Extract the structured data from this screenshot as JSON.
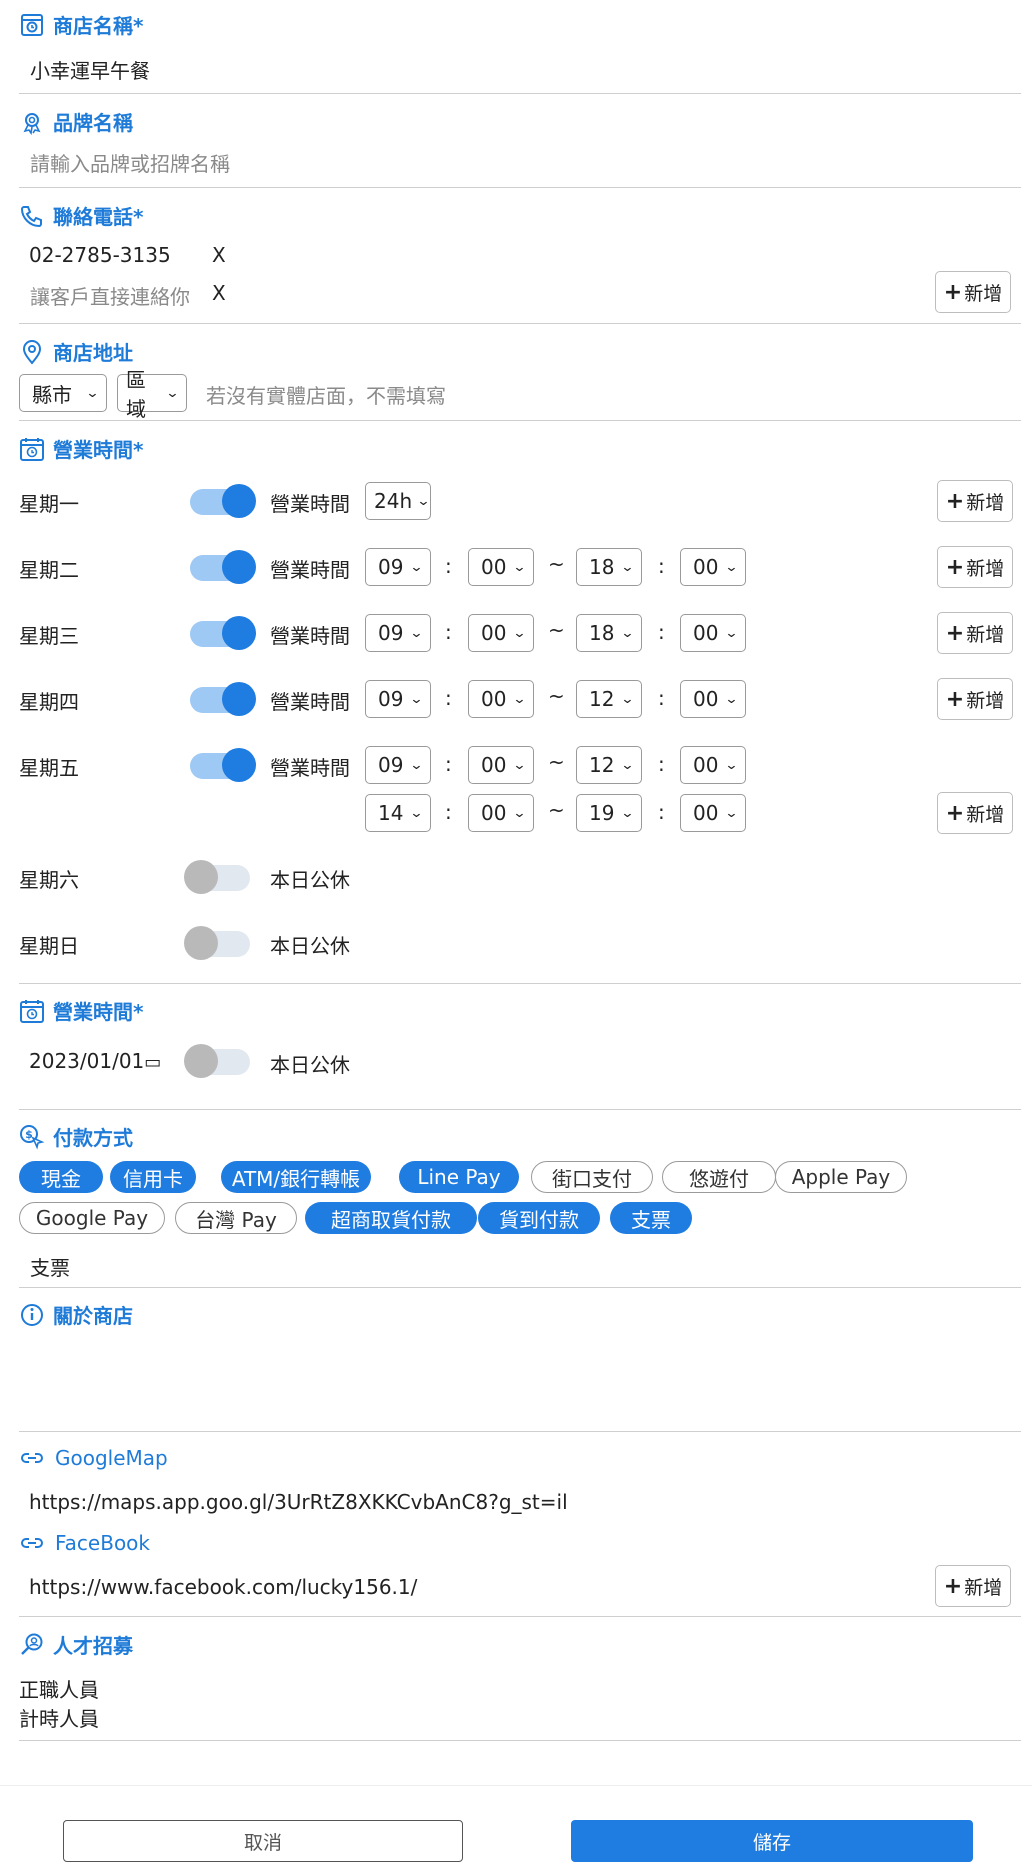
{
  "store_name": {
    "title": "商店名稱*",
    "value": "小幸運早午餐"
  },
  "brand_name": {
    "title": "品牌名稱",
    "placeholder": "請輸入品牌或招牌名稱"
  },
  "phone": {
    "title": "聯絡電話*",
    "numbers": [
      "02-2785-3135"
    ],
    "placeholder": "讓客戶直接連絡你",
    "remove_label": "X",
    "add_label": "新增"
  },
  "address": {
    "title": "商店地址",
    "county": "縣市",
    "district": "區域",
    "hint": "若沒有實體店面，不需填寫"
  },
  "hours": {
    "title": "營業時間*",
    "hours_label": "營業時間",
    "closed_label": "本日公休",
    "add_label": "新增",
    "days": [
      {
        "name": "星期一",
        "open": true,
        "mode": "24h",
        "ranges": []
      },
      {
        "name": "星期二",
        "open": true,
        "ranges": [
          [
            "09",
            "00",
            "18",
            "00"
          ]
        ]
      },
      {
        "name": "星期三",
        "open": true,
        "ranges": [
          [
            "09",
            "00",
            "18",
            "00"
          ]
        ]
      },
      {
        "name": "星期四",
        "open": true,
        "ranges": [
          [
            "09",
            "00",
            "12",
            "00"
          ]
        ]
      },
      {
        "name": "星期五",
        "open": true,
        "ranges": [
          [
            "09",
            "00",
            "12",
            "00"
          ],
          [
            "14",
            "00",
            "19",
            "00"
          ]
        ]
      },
      {
        "name": "星期六",
        "open": false
      },
      {
        "name": "星期日",
        "open": false
      }
    ]
  },
  "special_hours": {
    "title": "營業時間*",
    "date": "2023/01/01",
    "closed_label": "本日公休"
  },
  "payment": {
    "title": "付款方式",
    "methods": [
      {
        "label": "現金",
        "selected": true
      },
      {
        "label": "信用卡",
        "selected": true
      },
      {
        "label": "ATM/銀行轉帳",
        "selected": true
      },
      {
        "label": "Line Pay",
        "selected": true
      },
      {
        "label": "街口支付",
        "selected": false
      },
      {
        "label": "悠遊付",
        "selected": false
      },
      {
        "label": "Apple Pay",
        "selected": false
      },
      {
        "label": "Google Pay",
        "selected": false
      },
      {
        "label": "台灣 Pay",
        "selected": false
      },
      {
        "label": "超商取貨付款",
        "selected": true
      },
      {
        "label": "貨到付款",
        "selected": true
      },
      {
        "label": "支票",
        "selected": true
      }
    ],
    "note": "支票"
  },
  "about": {
    "title": "關於商店",
    "value": ""
  },
  "links": [
    {
      "title": "GoogleMap",
      "url": "https://maps.app.goo.gl/3UrRtZ8XKKCvbAnC8?g_st=il"
    },
    {
      "title": "FaceBook",
      "url": "https://www.facebook.com/lucky156.1/"
    }
  ],
  "links_add_label": "新增",
  "recruit": {
    "title": "人才招募",
    "items": [
      "正職人員",
      "計時人員"
    ]
  },
  "footer": {
    "cancel": "取消",
    "save": "儲存"
  },
  "colors": {
    "accent": "#1f7ce0",
    "toggle_on": "#9ec9f4",
    "toggle_off": "#e2e8ef"
  }
}
